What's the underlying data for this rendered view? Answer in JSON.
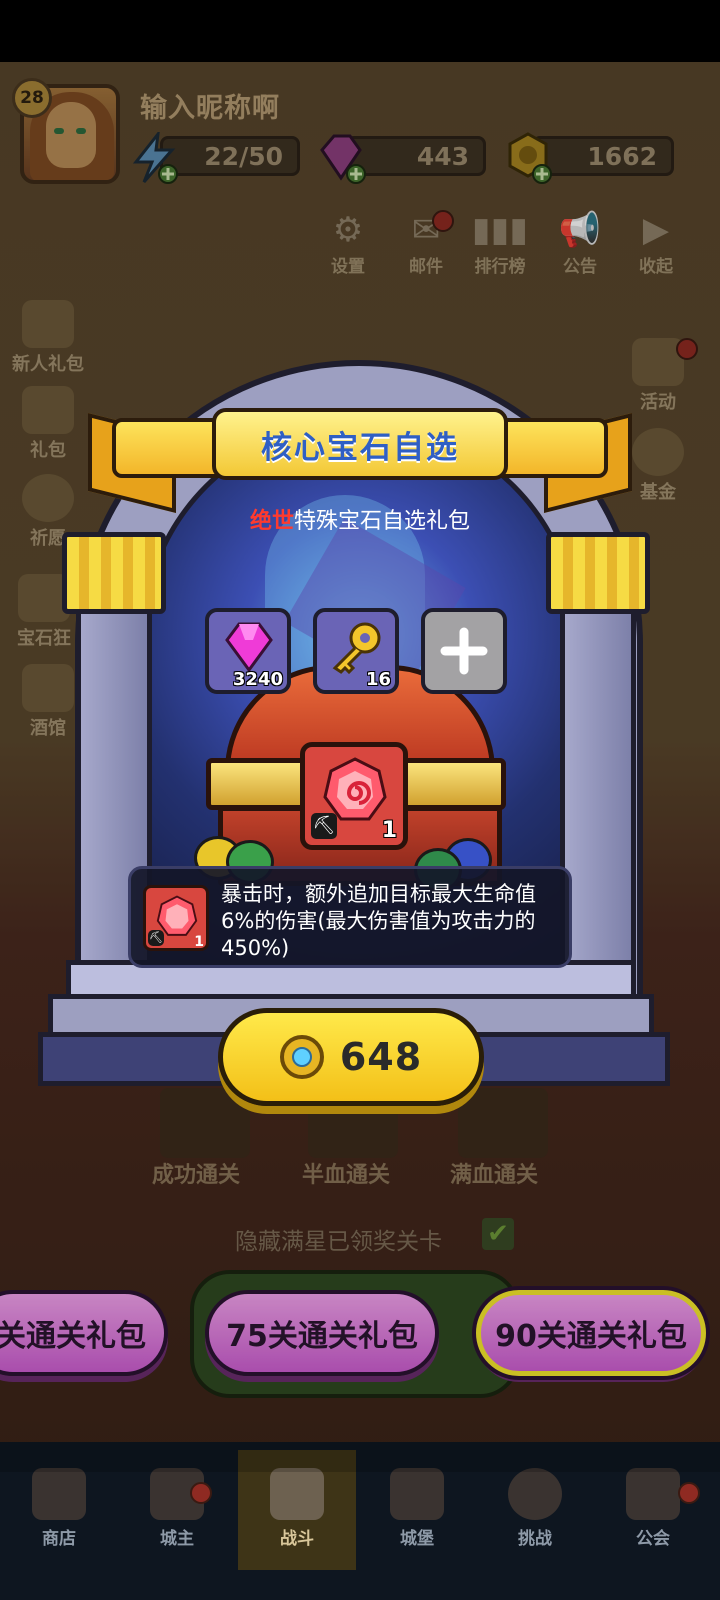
{
  "player": {
    "level": "28",
    "nickname": "输入昵称啊",
    "energy": "22/50",
    "gems": "443",
    "gold": "1662"
  },
  "top_icons": [
    {
      "label": "设置",
      "icon": "gear-icon"
    },
    {
      "label": "邮件",
      "icon": "mail-icon"
    },
    {
      "label": "排行榜",
      "icon": "leaderboard-icon"
    },
    {
      "label": "公告",
      "icon": "megaphone-icon"
    },
    {
      "label": "收起",
      "icon": "collapse-icon"
    }
  ],
  "left_menu": [
    "新人礼包",
    "礼包",
    "祈愿",
    "宝石狂",
    "酒馆"
  ],
  "right_menu": [
    "活动",
    "基金"
  ],
  "dialog": {
    "title": "核心宝石自选",
    "subtitle_highlight": "绝世",
    "subtitle_rest": "特殊宝石自选礼包",
    "slots": [
      {
        "icon": "pink-gem-icon",
        "count": "3240"
      },
      {
        "icon": "gold-key-icon",
        "count": "16"
      },
      {
        "icon": "plus-icon",
        "count": ""
      }
    ],
    "reward": {
      "icon": "red-gem-icon",
      "count": "1"
    },
    "description": "暴击时，额外追加目标最大生命值6%的伤害(最大伤害值为攻击力的450%)",
    "price": "648"
  },
  "stage": {
    "chest_labels": [
      "成功通关",
      "半血通关",
      "满血通关"
    ],
    "hide_label": "隐藏满星已领奖关卡"
  },
  "pills": [
    "关通关礼包",
    "75关通关礼包",
    "90关通关礼包"
  ],
  "nav": [
    {
      "label": "商店",
      "icon": "shop-icon"
    },
    {
      "label": "城主",
      "icon": "crown-icon"
    },
    {
      "label": "战斗",
      "icon": "swords-icon"
    },
    {
      "label": "城堡",
      "icon": "castle-icon"
    },
    {
      "label": "挑战",
      "icon": "demon-icon"
    },
    {
      "label": "公会",
      "icon": "guild-flag-icon"
    }
  ],
  "colors": {
    "highlight": "#ff3a2e",
    "title_text": "#2f5fc4",
    "buy_button": "#f6d12a",
    "selected_pill_border": "#f7ea2c"
  }
}
